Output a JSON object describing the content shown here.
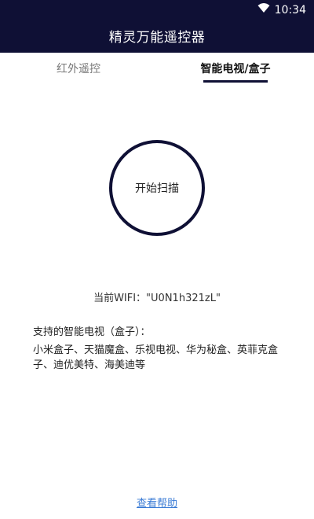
{
  "status_bar": {
    "time": "10:34",
    "icons": [
      "wifi-icon"
    ]
  },
  "app_bar": {
    "title": "精灵万能遥控器"
  },
  "tabs": [
    {
      "label": "红外遥控",
      "selected": false
    },
    {
      "label": "智能电视/盒子",
      "selected": true
    }
  ],
  "scan": {
    "button_label": "开始扫描"
  },
  "wifi": {
    "text": "当前WIFI：\"U0N1h321zL\""
  },
  "supported": {
    "title": "支持的智能电视（盒子）：",
    "list": "小米盒子、天猫魔盒、乐视电视、华为秘盒、英菲克盒子、迪优美特、海美迪等"
  },
  "help": {
    "link_label": "查看帮助"
  },
  "colors": {
    "primary": "#0f1035",
    "link": "#3a7bd5"
  }
}
